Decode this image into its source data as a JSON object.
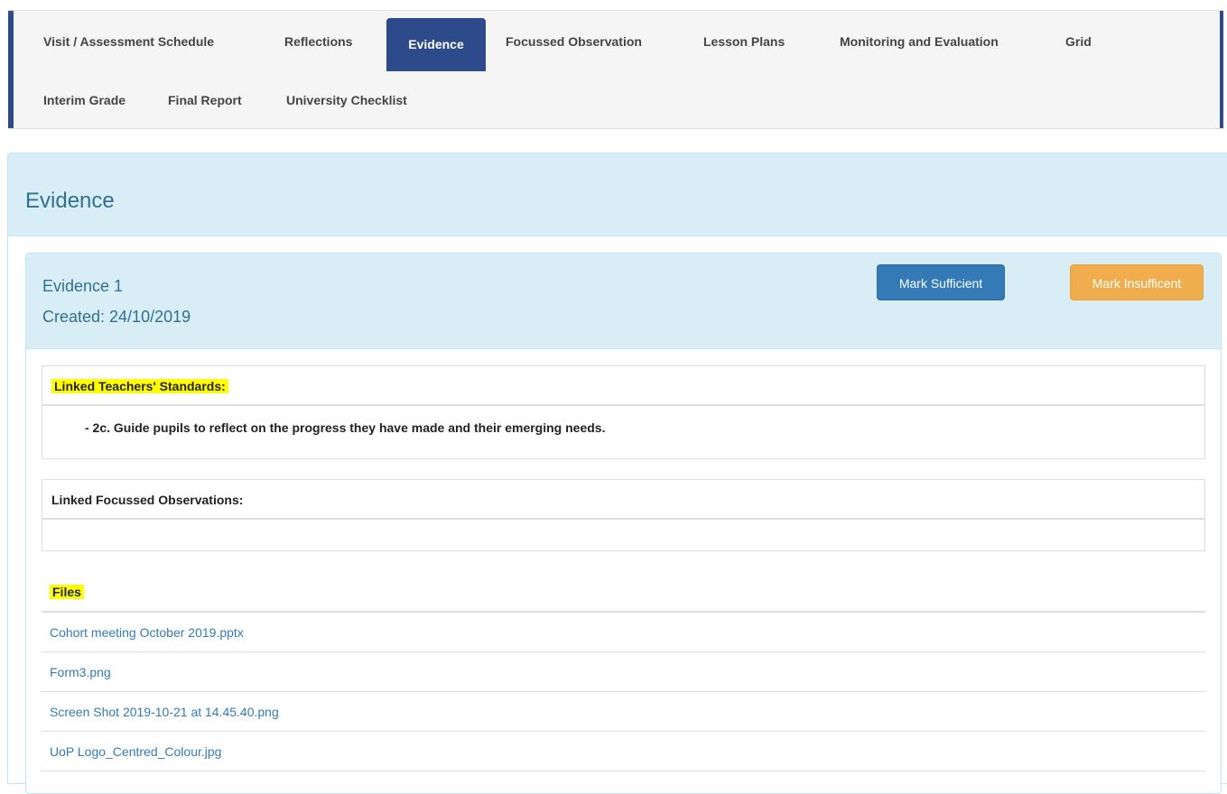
{
  "nav": {
    "tabs_row1": [
      "Visit / Assessment Schedule",
      "Reflections",
      "Evidence",
      "Focussed Observation",
      "Lesson Plans",
      "Monitoring and Evaluation",
      "Grid"
    ],
    "tabs_row2": [
      "Interim Grade",
      "Final Report",
      "University Checklist"
    ],
    "active_tab": "Evidence"
  },
  "page": {
    "title": "Evidence"
  },
  "evidence": {
    "name": "Evidence 1",
    "created": "Created: 24/10/2019",
    "mark_sufficient_label": "Mark Sufficient",
    "mark_insufficient_label": "Mark Insufficent",
    "linked_standards_label": "Linked Teachers' Standards:",
    "linked_standards": [
      "- 2c. Guide pupils to reflect on the progress they have made and their emerging needs."
    ],
    "linked_observations_label": "Linked Focussed Observations:",
    "files_label": "Files",
    "files": [
      "Cohort meeting October 2019.pptx",
      "Form3.png",
      "Screen Shot 2019-10-21 at 14.45.40.png",
      "UoP Logo_Centred_Colour.jpg"
    ]
  },
  "colors": {
    "nav_accent": "#2d4a8a",
    "panel_heading_bg": "#d9edf7",
    "panel_text": "#31708f",
    "primary_button": "#337ab7",
    "warning_button": "#f0ad4e",
    "highlight": "#ffff00"
  }
}
